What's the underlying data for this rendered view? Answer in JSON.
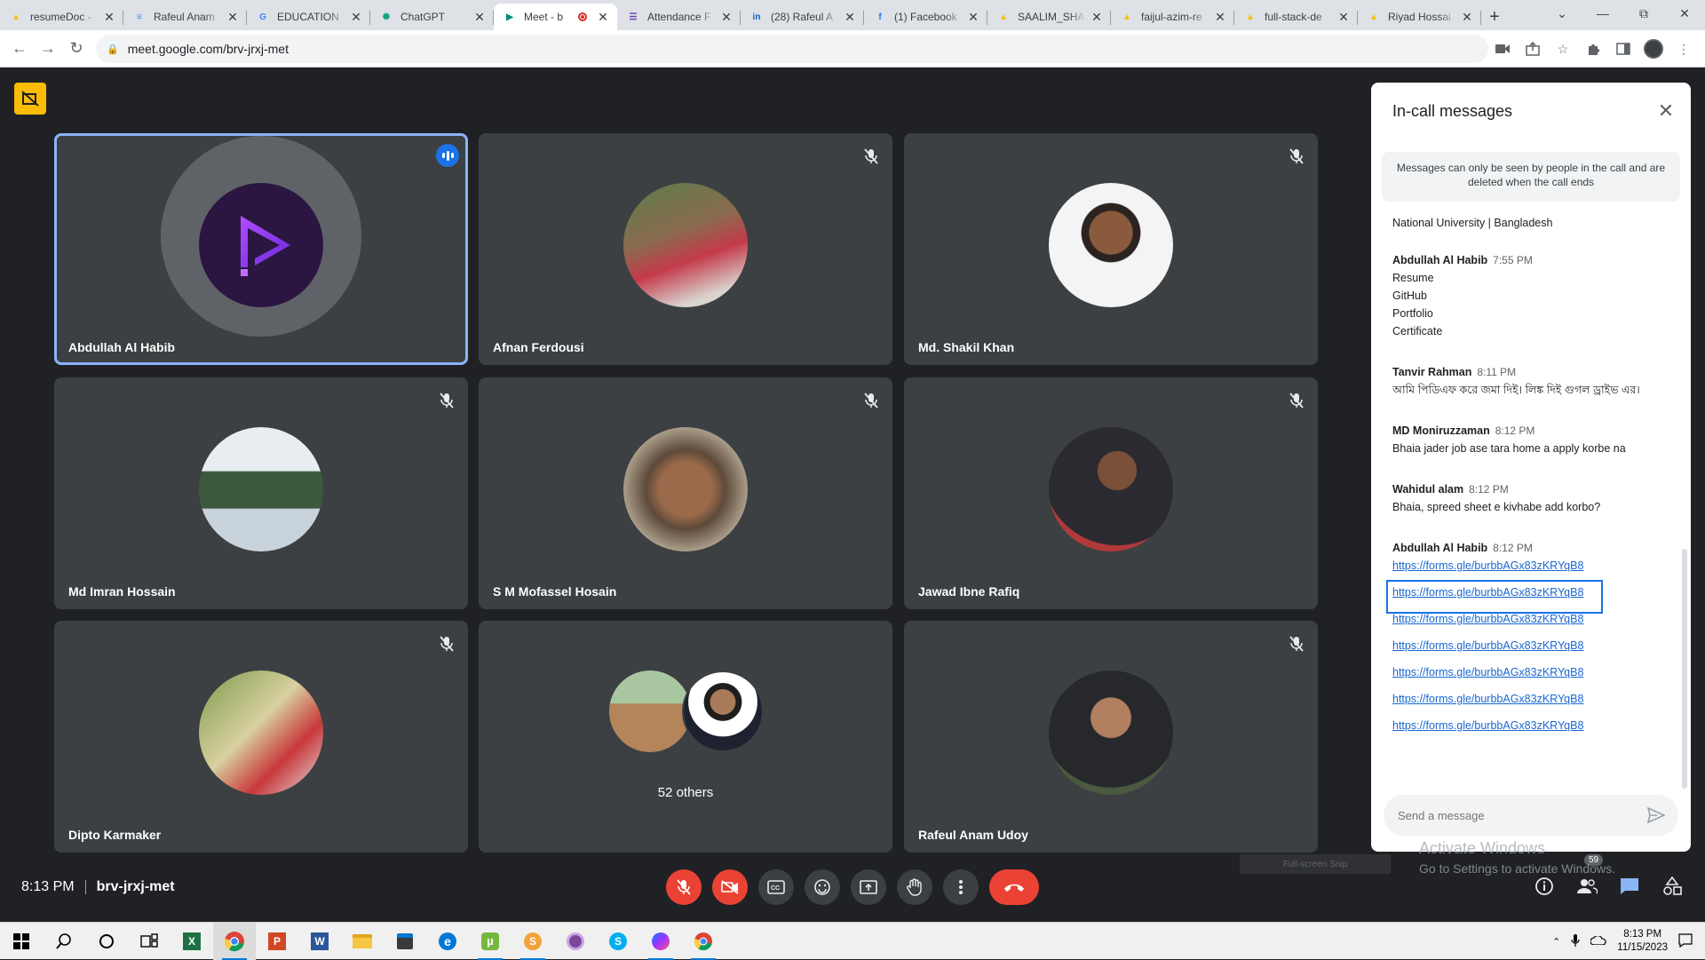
{
  "browser": {
    "tabs": [
      {
        "title": "resumeDoc -",
        "icon": "drive-icon",
        "color": "#fbbc04"
      },
      {
        "title": "Rafeul Anam",
        "icon": "docs-icon",
        "color": "#4285f4"
      },
      {
        "title": "EDUCATION",
        "icon": "google-icon",
        "color": "#4285f4"
      },
      {
        "title": "ChatGPT",
        "icon": "chatgpt-icon",
        "color": "#10a37f"
      },
      {
        "title": "Meet - b",
        "icon": "meet-icon",
        "color": "#00897b",
        "active": true
      },
      {
        "title": "Attendance F",
        "icon": "forms-icon",
        "color": "#673ab7"
      },
      {
        "title": "(28) Rafeul A",
        "icon": "linkedin-icon",
        "color": "#0a66c2"
      },
      {
        "title": "(1) Facebook",
        "icon": "facebook-icon",
        "color": "#1877f2"
      },
      {
        "title": "SAALIM_SHA",
        "icon": "drive-icon",
        "color": "#fbbc04"
      },
      {
        "title": "faijul-azim-re",
        "icon": "drive-icon",
        "color": "#fbbc04"
      },
      {
        "title": "full-stack-de",
        "icon": "drive-icon",
        "color": "#fbbc04"
      },
      {
        "title": "Riyad Hossai",
        "icon": "drive-icon",
        "color": "#fbbc04"
      }
    ],
    "url": "meet.google.com/brv-jrxj-met"
  },
  "meeting": {
    "time": "8:13 PM",
    "code": "brv-jrxj-met",
    "participant_count": "59",
    "others_label": "52 others",
    "participants": [
      {
        "name": "Abdullah Al Habib",
        "speaking": true,
        "muted": false
      },
      {
        "name": "Afnan Ferdousi",
        "muted": true
      },
      {
        "name": "Md. Shakil Khan",
        "muted": true
      },
      {
        "name": "Md Imran Hossain",
        "muted": true
      },
      {
        "name": "S M Mofassel Hosain",
        "muted": true
      },
      {
        "name": "Jawad Ibne Rafiq",
        "muted": true
      },
      {
        "name": "Dipto Karmaker",
        "muted": true
      },
      {
        "name": "Rafeul Anam Udoy",
        "muted": true
      }
    ]
  },
  "chat": {
    "title": "In-call messages",
    "notice": "Messages can only be seen by people in the call and are deleted when the call ends",
    "fragment": "National University | Bangladesh",
    "messages": [
      {
        "sender": "Abdullah Al Habib",
        "time": "7:55 PM",
        "lines": [
          "Resume",
          "GitHub",
          "Portfolio",
          "Certificate"
        ]
      },
      {
        "sender": "Tanvir Rahman",
        "time": "8:11 PM",
        "lines": [
          "আমি পিডিএফ করে জমা দিই। লিঙ্ক দিই গুগল ড্রাইভ এর।"
        ]
      },
      {
        "sender": "MD Moniruzzaman",
        "time": "8:12 PM",
        "lines": [
          "Bhaia jader job ase tara home a apply korbe na"
        ]
      },
      {
        "sender": "Wahidul alam",
        "time": "8:12 PM",
        "lines": [
          "Bhaia, spreed sheet e kivhabe add korbo?"
        ]
      },
      {
        "sender": "Abdullah Al Habib",
        "time": "8:12 PM",
        "links": [
          "https://forms.gle/burbbAGx83zKRYqB8",
          "https://forms.gle/burbbAGx83zKRYqB8",
          "https://forms.gle/burbbAGx83zKRYqB8",
          "https://forms.gle/burbbAGx83zKRYqB8",
          "https://forms.gle/burbbAGx83zKRYqB8",
          "https://forms.gle/burbbAGx83zKRYqB8",
          "https://forms.gle/burbbAGx83zKRYqB8"
        ]
      }
    ],
    "input_placeholder": "Send a message"
  },
  "overlay": {
    "activate_title": "Activate Windows",
    "activate_sub": "Go to Settings to activate Windows.",
    "fullscreen_hint": "Full-screen Snip"
  },
  "taskbar": {
    "time": "8:13 PM",
    "date": "11/15/2023"
  },
  "colors": {
    "meet_bg": "#202124",
    "tile_bg": "#3c4043",
    "accent_blue": "#8ab4f8",
    "end_call_red": "#ea4335",
    "rec_badge": "#fbbc04"
  }
}
